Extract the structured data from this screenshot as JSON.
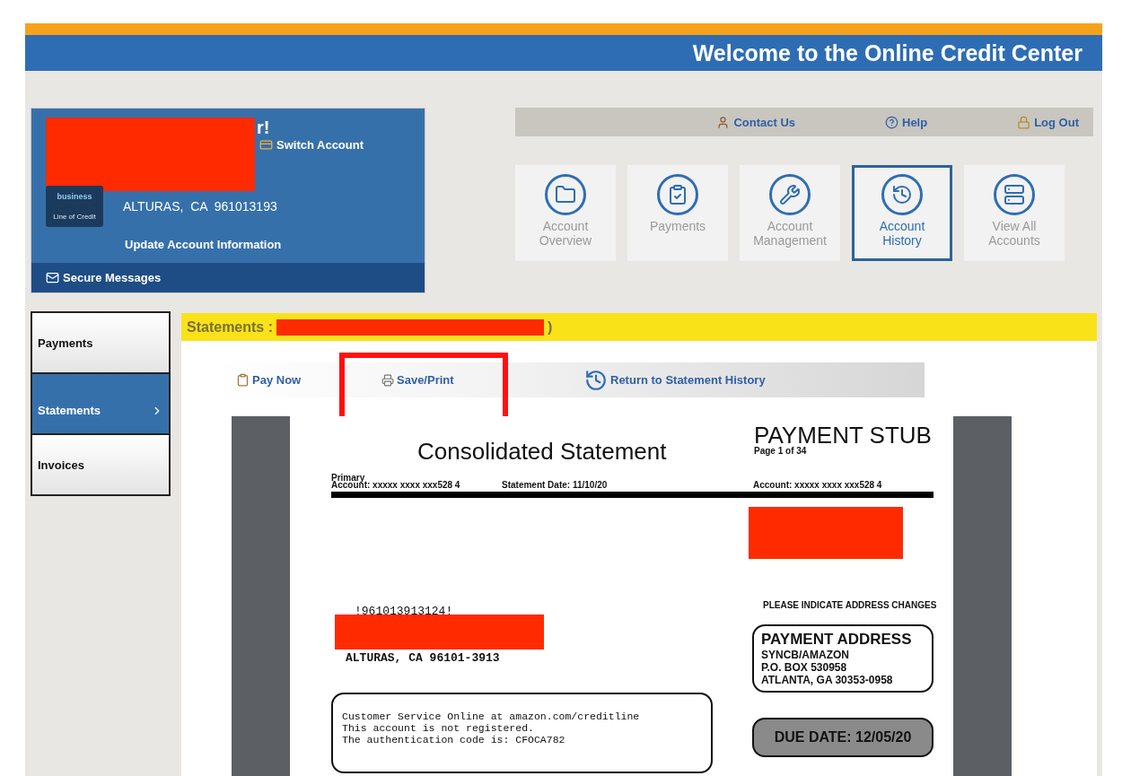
{
  "header": {
    "title": "Welcome to the Online Credit Center"
  },
  "account_card": {
    "greeting_tail": "r!",
    "switch_account": "Switch Account",
    "logo_top": "business",
    "logo_bottom": "Line of Credit",
    "address": "ALTURAS,  CA  961013193",
    "update_link": "Update Account Information",
    "secure_messages": "Secure Messages"
  },
  "top_links": [
    {
      "kind": "contact",
      "label": "Contact Us"
    },
    {
      "kind": "help",
      "label": "Help"
    },
    {
      "kind": "logout",
      "label": "Log Out"
    }
  ],
  "tiles": [
    {
      "kind": "folder",
      "label": "Account Overview",
      "selected": false
    },
    {
      "kind": "clipboard",
      "label": "Payments",
      "selected": false
    },
    {
      "kind": "tools",
      "label": "Account Management",
      "selected": false
    },
    {
      "kind": "clock",
      "label": "Account History",
      "selected": true
    },
    {
      "kind": "cabinet",
      "label": "View All Accounts",
      "selected": false
    }
  ],
  "sidebar": {
    "items": [
      {
        "label": "Payments",
        "selected": false
      },
      {
        "label": "Statements",
        "selected": true
      },
      {
        "label": "Invoices",
        "selected": false
      }
    ]
  },
  "statement_panel": {
    "title": "Statements :",
    "title_tail": ")",
    "toolbar": [
      {
        "kind": "pay",
        "label": "Pay Now",
        "highlighted": false
      },
      {
        "kind": "print",
        "label": "Save/Print",
        "highlighted": true
      },
      {
        "kind": "history",
        "label": "Return to Statement History",
        "highlighted": false
      }
    ],
    "document": {
      "title": "Consolidated Statement",
      "primary": "Primary",
      "account": "Account: xxxxx xxxx xxx528 4",
      "statement_date": "Statement Date: 11/10/20",
      "stub_title": "PAYMENT STUB",
      "page": "Page 1 of 34",
      "stub_account": "Account: xxxxx xxxx xxx528 4",
      "barcode_number": "!961013913124!",
      "address_city": "ALTURAS, CA 96101-3913",
      "address_changes": "PLEASE INDICATE ADDRESS CHANGES",
      "payment_address": {
        "title": "PAYMENT ADDRESS",
        "lines": [
          "SYNCB/AMAZON",
          "P.O. BOX 530958",
          "ATLANTA, GA 30353-0958"
        ]
      },
      "notice_lines": [
        "Customer Service Online at amazon.com/creditline",
        "This account is not registered.",
        "The authentication code is: CFOCA782"
      ],
      "due_date": "DUE DATE: 12/05/20"
    }
  }
}
